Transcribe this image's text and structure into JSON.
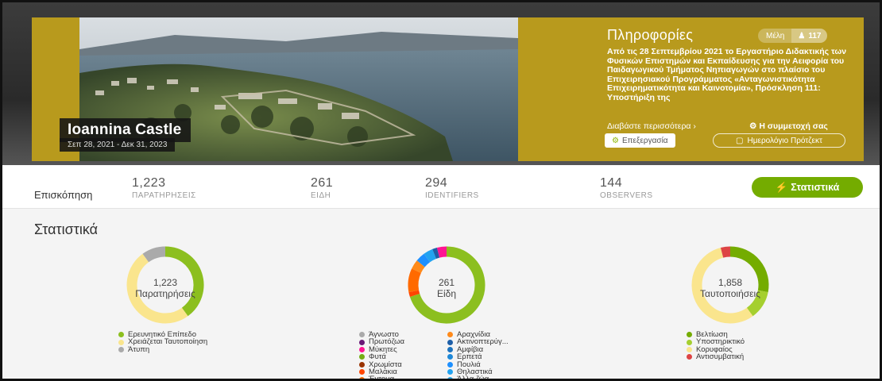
{
  "project": {
    "title": "Ioannina Castle",
    "dates": "Σεπ 28, 2021 - Δεκ 31, 2023"
  },
  "info": {
    "title": "Πληροφορίες",
    "members_label": "Μέλη",
    "members_count": "117",
    "description": "Από τις 28 Σεπτεμβρίου 2021 το Εργαστήριο Διδακτικής των Φυσικών Επιστημών και Εκπαίδευσης για την Αειφορία του Παιδαγωγικού Τμήματος Νηπιαγωγών στο πλαίσιο του Επιχειρησιακού Προγράμματος «Ανταγωνιστικότητα Επιχειρηματικότητα και Καινοτομία», Πρόσκληση 111: Υποστήριξη της",
    "read_more": "Διαβάστε περισσότερα ›",
    "participation": "Η συμμετοχή σας",
    "edit_button": "Επεξεργασία",
    "calendar_button": "Ημερολόγιο Πρότζεκτ"
  },
  "stats_bar": {
    "overview": "Επισκόπηση",
    "observations_value": "1,223",
    "observations_label": "ΠΑΡΑΤΗΡΗΣΕΙΣ",
    "species_value": "261",
    "species_label": "ΕΙΔΗ",
    "identifiers_value": "294",
    "identifiers_label": "IDENTIFIERS",
    "observers_value": "144",
    "observers_label": "OBSERVERS",
    "stats_button": "Στατιστικά"
  },
  "section_title": "Στατιστικά",
  "charts": {
    "observations": {
      "center_value": "1,223",
      "center_label": "Παρατηρήσεις",
      "legend": [
        {
          "label": "Ερευνητικό Επίπεδο",
          "color": "#8cbf1f"
        },
        {
          "label": "Χρειάζεται Ταυτοποίηση",
          "color": "#fae58d"
        },
        {
          "label": "Άτυπη",
          "color": "#aaaaaa"
        }
      ]
    },
    "species": {
      "center_value": "261",
      "center_label": "Είδη",
      "legend_col1": [
        {
          "label": "Άγνωστο",
          "color": "#aaaaaa"
        },
        {
          "label": "Πρωτόζωα",
          "color": "#691776"
        },
        {
          "label": "Μύκητες",
          "color": "#ff1493"
        },
        {
          "label": "Φυτά",
          "color": "#73ac13"
        },
        {
          "label": "Χρωμίστα",
          "color": "#993300"
        },
        {
          "label": "Μαλάκια",
          "color": "#ff4500"
        },
        {
          "label": "Έντομα",
          "color": "#ff6a00"
        }
      ],
      "legend_col2": [
        {
          "label": "Αραχνίδια",
          "color": "#ff8a1a"
        },
        {
          "label": "Ακτινοπτερύγ...",
          "color": "#1e5fa8"
        },
        {
          "label": "Αμφίβια",
          "color": "#1e73be"
        },
        {
          "label": "Ερπετά",
          "color": "#1e88d8"
        },
        {
          "label": "Πουλιά",
          "color": "#1e90ff"
        },
        {
          "label": "Θηλαστικά",
          "color": "#23a3f0"
        },
        {
          "label": "Άλλα ζώα",
          "color": "#2aa7ea"
        }
      ]
    },
    "identifications": {
      "center_value": "1,858",
      "center_label": "Ταυτοποιήσεις",
      "legend": [
        {
          "label": "Βελτίωση",
          "color": "#74ac00"
        },
        {
          "label": "Υποστηρικτικό",
          "color": "#a5cf2f"
        },
        {
          "label": "Κορυφαίος",
          "color": "#fae58d"
        },
        {
          "label": "Αντισυμβατική",
          "color": "#dd4444"
        }
      ]
    }
  },
  "chart_data": [
    {
      "type": "pie",
      "title": "Παρατηρήσεις",
      "categories": [
        "Ερευνητικό Επίπεδο",
        "Χρειάζεται Ταυτοποίηση",
        "Άτυπη"
      ],
      "values": [
        0.4,
        0.5,
        0.1
      ],
      "colors": [
        "#8cbf1f",
        "#fae58d",
        "#aaaaaa"
      ]
    },
    {
      "type": "pie",
      "title": "Είδη",
      "categories": [
        "Φυτά",
        "Μαλάκια",
        "Έντομα",
        "Αραχνίδια",
        "Πουλιά",
        "Θηλαστικά",
        "Ακτινοπτερύγ...",
        "Μύκητες"
      ],
      "values": [
        0.7,
        0.02,
        0.1,
        0.04,
        0.04,
        0.04,
        0.02,
        0.04
      ],
      "colors": [
        "#8cbf1f",
        "#ff4500",
        "#ff6a00",
        "#ff8a1a",
        "#1e90ff",
        "#23a3f0",
        "#1e5fa8",
        "#ff1493"
      ]
    },
    {
      "type": "pie",
      "title": "Ταυτοποιήσεις",
      "categories": [
        "Βελτίωση",
        "Υποστηρικτικό",
        "Κορυφαίος",
        "Αντισυμβατική"
      ],
      "values": [
        0.28,
        0.12,
        0.56,
        0.04
      ],
      "colors": [
        "#74ac00",
        "#a5cf2f",
        "#fae58d",
        "#dd4444"
      ]
    }
  ]
}
